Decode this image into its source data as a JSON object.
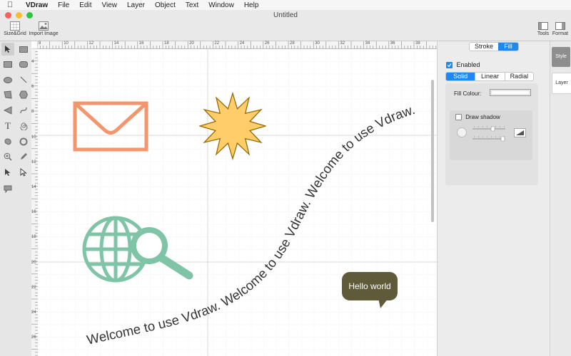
{
  "menubar": {
    "app_name": "VDraw",
    "items": [
      "File",
      "Edit",
      "View",
      "Layer",
      "Object",
      "Text",
      "Window",
      "Help"
    ]
  },
  "window": {
    "title": "Untitled"
  },
  "toolbar": {
    "size_grid_label": "Size&Grid",
    "import_image_label": "Import Image",
    "tools_label": "Tools",
    "format_label": "Format"
  },
  "ruler": {
    "top_ticks": [
      "8",
      "10",
      "12",
      "14",
      "16",
      "18",
      "20",
      "22",
      "24",
      "26",
      "28",
      "30",
      "32",
      "34",
      "36",
      "38"
    ],
    "left_ticks": [
      "4",
      "6",
      "8",
      "10",
      "12",
      "14",
      "16",
      "18",
      "20",
      "22",
      "24",
      "26"
    ]
  },
  "canvas": {
    "curved_text": "Welcome to use Vdraw.  Welcome to use Vdraw. Welcome to use Vdraw.",
    "bubble_text": "Hello world",
    "colors": {
      "envelope": "#f5956b",
      "star_fill": "#ffce6a",
      "star_stroke": "#9a6b00",
      "globe": "#7fc4a6",
      "bubble": "#5f5a3a"
    }
  },
  "inspector": {
    "tabs": [
      "Stroke",
      "Fill"
    ],
    "active_tab": "Fill",
    "enabled_label": "Enabled",
    "fill_types": [
      "Solid",
      "Linear",
      "Radial"
    ],
    "active_fill_type": "Solid",
    "fill_colour_label": "Fill Colour:",
    "draw_shadow_label": "Draw shadow"
  },
  "side_tabs": {
    "style_label": "Style",
    "layer_label": "Layer"
  }
}
